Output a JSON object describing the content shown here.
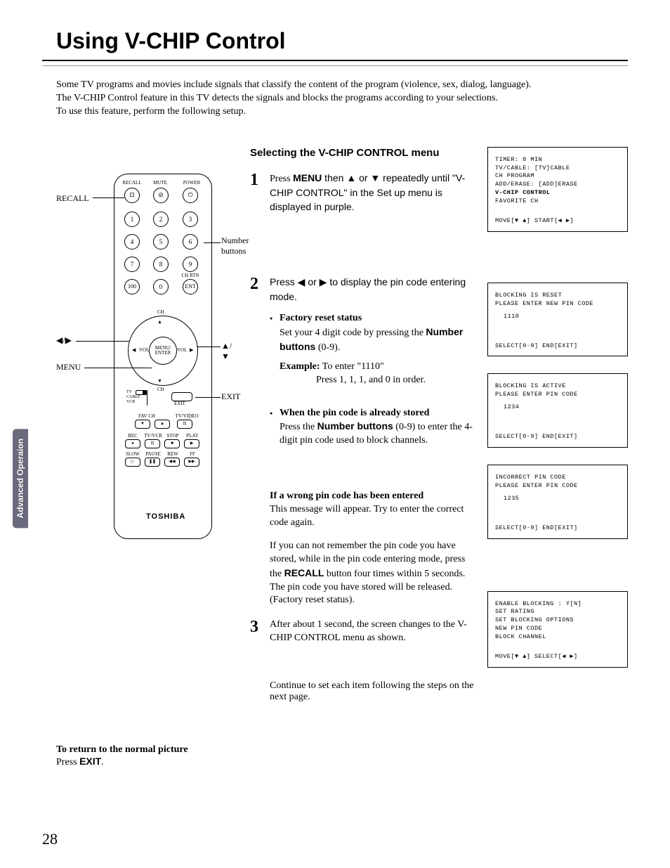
{
  "page_title": "Using V-CHIP Control",
  "intro_lines": [
    "Some TV programs and movies include signals that classify the content of the program (violence, sex, dialog, language).",
    "The V-CHIP Control feature in this TV detects the signals and blocks the programs according to your selections.",
    "To use this feature, perform the following setup."
  ],
  "side_tab": "Advanced Operaion",
  "remote_labels": {
    "recall": "RECALL",
    "number_buttons": "Number buttons",
    "left_right": "◀/▶",
    "up_down": "▲/▼",
    "menu": "MENU",
    "exit_cb": "EXIT",
    "top": {
      "recall": "RECALL",
      "mute": "MUTE",
      "power": "POWER"
    },
    "numbers": [
      "1",
      "2",
      "3",
      "4",
      "5",
      "6",
      "7",
      "8",
      "9",
      "100",
      "0",
      "ENT"
    ],
    "chrtn": "CH RTN",
    "ring": {
      "ch": "CH",
      "vol": "VOL",
      "center": "MENU/\nENTER"
    },
    "switch": [
      "TV",
      "CABLE",
      "VCR"
    ],
    "exit": "EXIT",
    "row1": {
      "favch": "FAV CH",
      "tvvideo": "TV/VIDEO"
    },
    "row2": {
      "rec": "REC",
      "tvvcr": "TV/VCR",
      "stop": "STOP",
      "play": "PLAY"
    },
    "row3": {
      "slow": "SLOW",
      "pause": "PAUSE",
      "rew": "REW",
      "ff": "FF"
    },
    "brand": "TOSHIBA"
  },
  "return_note": {
    "line1": "To return to the normal picture",
    "line2_a": "Press ",
    "line2_b": "EXIT",
    "line2_c": "."
  },
  "subhead": "Selecting the V-CHIP CONTROL menu",
  "step1": {
    "num": "1",
    "a": "Press ",
    "menu": "MENU",
    "b": " then ▲ or ▼ repeatedly until \"V-CHIP CONTROL\" in the Set up menu is displayed in purple."
  },
  "step2": {
    "num": "2",
    "lead": "Press ◀ or ▶ to display the pin code entering mode.",
    "b1_head": "Factory reset status",
    "b1_a": "Set your 4 digit code by pressing the ",
    "b1_nb": "Number buttons",
    "b1_b": " (0-9).",
    "ex_label": "Example:",
    "ex_a": " To enter \"1110\"",
    "ex_b": "Press 1, 1, 1, and 0 in order.",
    "b2_head": "When the pin code is already stored",
    "b2_a": "Press the ",
    "b2_nb": "Number buttons",
    "b2_b": " (0-9) to enter the 4-digit pin code used to block channels.",
    "wrong_head": "If a wrong pin code has been entered",
    "wrong_body": "This message will appear. Try to enter the correct code again.",
    "recall_para": "If you can not remember the pin code you have stored, while in the pin code entering mode, press the RECALL button four times within 5 seconds.\nThe pin code you have stored will be released. (Factory reset status).",
    "recall_a": "If you can not remember the pin code you have stored, while in the pin code entering mode, press the ",
    "recall_kw": "RECALL",
    "recall_b": " button four times within 5 seconds.",
    "recall_c": "The pin code you have stored will be released. (Factory reset status)."
  },
  "step3": {
    "num": "3",
    "text": "After about 1 second, the screen changes to the V-CHIP CONTROL menu as shown."
  },
  "continue": "Continue to set each item following the steps on the next page.",
  "page_number": "28",
  "screens": {
    "s1": {
      "l1": "TIMER:            0 MIN",
      "l2": "TV/CABLE:      [TV]CABLE",
      "l3": "CH PROGRAM",
      "l4": "ADD/ERASE:    [ADD]ERASE",
      "l5": "V-CHIP CONTROL",
      "l6": "FAVORITE CH",
      "foot": "MOVE[▼ ▲] START[◀ ▶]"
    },
    "s2": {
      "l1": "BLOCKING IS RESET",
      "l2": "PLEASE ENTER NEW PIN CODE",
      "pin": "1110",
      "foot": "SELECT[0-9] END[EXIT]"
    },
    "s3": {
      "l1": "BLOCKING IS ACTIVE",
      "l2": "PLEASE ENTER PIN CODE",
      "pin": "1234",
      "foot": "SELECT[0-9] END[EXIT]"
    },
    "s4": {
      "l1": "INCORRECT PIN CODE",
      "l2": "PLEASE ENTER PIN CODE",
      "pin": "1235",
      "foot": "SELECT[0-9] END[EXIT]"
    },
    "s5": {
      "l1": "ENABLE BLOCKING :   Y[N]",
      "l2": "SET RATING",
      "l3": "SET BLOCKING OPTIONS",
      "l4": "NEW PIN CODE",
      "l5": "BLOCK CHANNEL",
      "foot": "MOVE[▼ ▲] SELECT[◀ ▶]"
    }
  }
}
